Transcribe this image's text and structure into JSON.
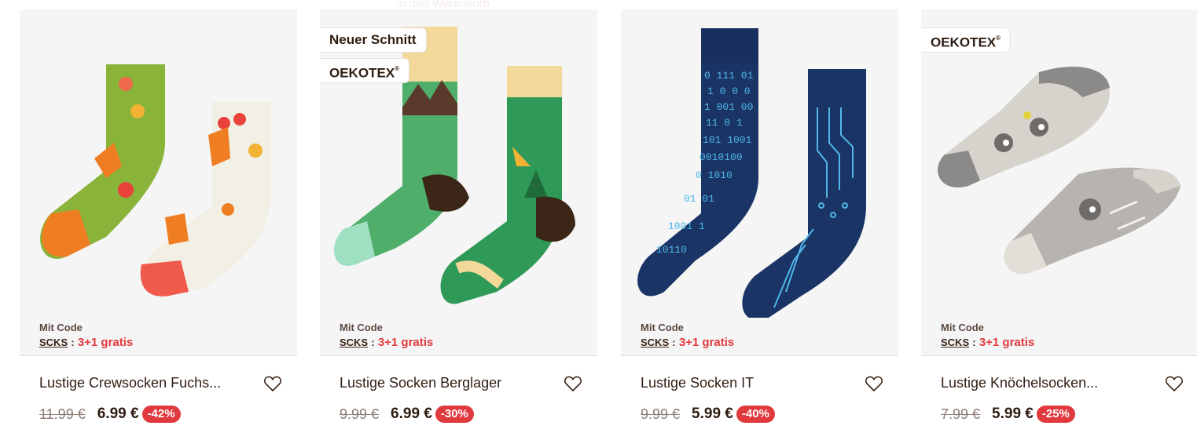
{
  "header": {
    "faded_text": "in den Warenkorb"
  },
  "products": [
    {
      "badges": [],
      "promo_label": "Mit Code",
      "promo_code": "SCKS",
      "promo_sep": ":",
      "promo_deal": "3+1 gratis",
      "name": "Lustige Crewsocken Fuchs...",
      "old_price": "11.99 €",
      "price": "6.99 €",
      "discount": "-42%"
    },
    {
      "badges": [
        "Neuer Schnitt",
        "OEKOTEX"
      ],
      "promo_label": "Mit Code",
      "promo_code": "SCKS",
      "promo_sep": ":",
      "promo_deal": "3+1 gratis",
      "name": "Lustige Socken Berglager",
      "old_price": "9.99 €",
      "price": "6.99 €",
      "discount": "-30%"
    },
    {
      "badges": [],
      "promo_label": "Mit Code",
      "promo_code": "SCKS",
      "promo_sep": ":",
      "promo_deal": "3+1 gratis",
      "name": "Lustige Socken IT",
      "old_price": "9.99 €",
      "price": "5.99 €",
      "discount": "-40%"
    },
    {
      "badges": [
        "OEKOTEX"
      ],
      "promo_label": "Mit Code",
      "promo_code": "SCKS",
      "promo_sep": ":",
      "promo_deal": "3+1 gratis",
      "name": "Lustige Knöchelsocken...",
      "old_price": "7.99 €",
      "price": "5.99 €",
      "discount": "-25%"
    }
  ],
  "colors": {
    "accent_red": "#e0393e",
    "text_brown": "#2f1d13",
    "card_bg": "#f5f5f5"
  }
}
